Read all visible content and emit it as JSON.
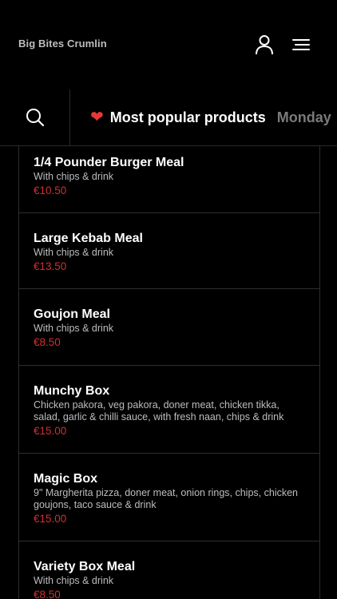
{
  "header": {
    "brand": "Big Bites Crumlin",
    "user_icon": "user-icon",
    "menu_icon": "hamburger-menu-icon"
  },
  "category_bar": {
    "search_icon": "search-icon",
    "tabs": [
      {
        "label": "Most popular products",
        "icon": "heart-icon",
        "active": true
      },
      {
        "label": "Monday",
        "active": false
      }
    ]
  },
  "colors": {
    "background": "#000000",
    "price": "#d32f2f",
    "heart": "#e53935",
    "muted_text": "#bdbdbd",
    "inactive_tab": "#7a7a7a"
  },
  "products": [
    {
      "name": "1/4 Pounder Burger Meal",
      "description": "With chips & drink",
      "price": "€10.50"
    },
    {
      "name": "Large Kebab Meal",
      "description": "With chips & drink",
      "price": "€13.50"
    },
    {
      "name": "Goujon Meal",
      "description": "With chips & drink",
      "price": "€8.50"
    },
    {
      "name": "Munchy Box",
      "description": "Chicken pakora, veg pakora, doner meat, chicken tikka, salad, garlic & chilli sauce, with fresh naan, chips & drink",
      "price": "€15.00"
    },
    {
      "name": "Magic Box",
      "description": "9\" Margherita pizza, doner meat, onion rings, chips, chicken goujons, taco sauce & drink",
      "price": "€15.00"
    },
    {
      "name": "Variety Box Meal",
      "description": "With chips & drink",
      "price": "€8.50"
    }
  ]
}
